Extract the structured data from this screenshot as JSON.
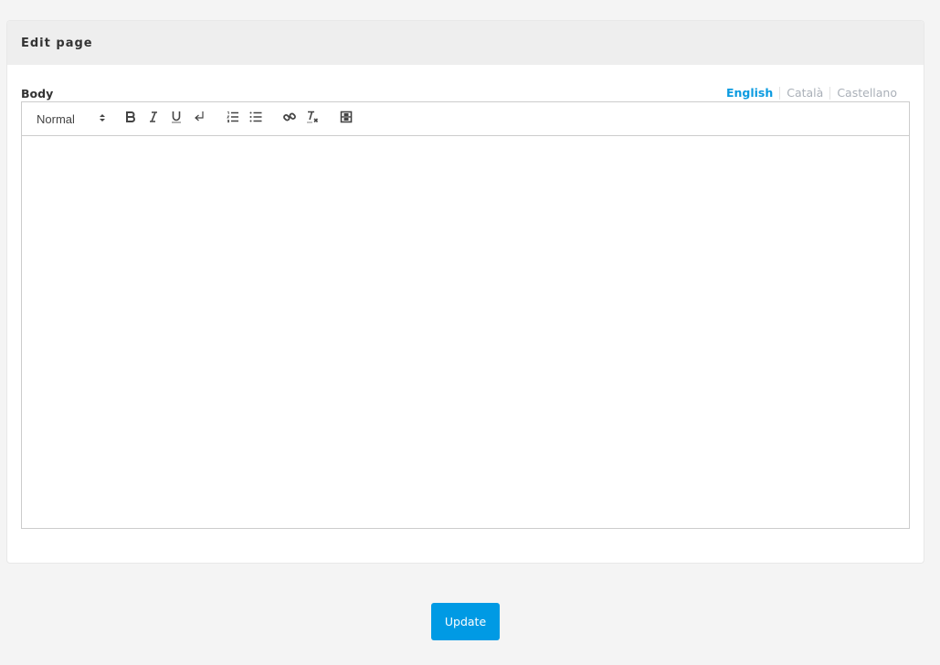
{
  "card": {
    "title": "Edit page"
  },
  "field": {
    "label": "Body"
  },
  "languages": [
    {
      "label": "English",
      "active": true
    },
    {
      "label": "Català",
      "active": false
    },
    {
      "label": "Castellano",
      "active": false
    }
  ],
  "toolbar": {
    "format_value": "Normal",
    "buttons": [
      {
        "icon": "bold-icon",
        "title": "Bold"
      },
      {
        "icon": "italic-icon",
        "title": "Italic"
      },
      {
        "icon": "underline-icon",
        "title": "Underline"
      },
      {
        "icon": "line-break-icon",
        "title": "Line break"
      },
      {
        "icon": "ordered-list-icon",
        "title": "Ordered list"
      },
      {
        "icon": "bullet-list-icon",
        "title": "Bullet list"
      },
      {
        "icon": "link-icon",
        "title": "Link"
      },
      {
        "icon": "clear-format-icon",
        "title": "Clear formatting"
      },
      {
        "icon": "video-icon",
        "title": "Video"
      }
    ]
  },
  "editor": {
    "content": ""
  },
  "actions": {
    "update_label": "Update"
  },
  "colors": {
    "accent": "#009ae4",
    "active_tab": "#0c9be0",
    "inactive_tab": "#aab0b8",
    "header_bg": "#eeeeee",
    "page_bg": "#f4f4f4"
  }
}
